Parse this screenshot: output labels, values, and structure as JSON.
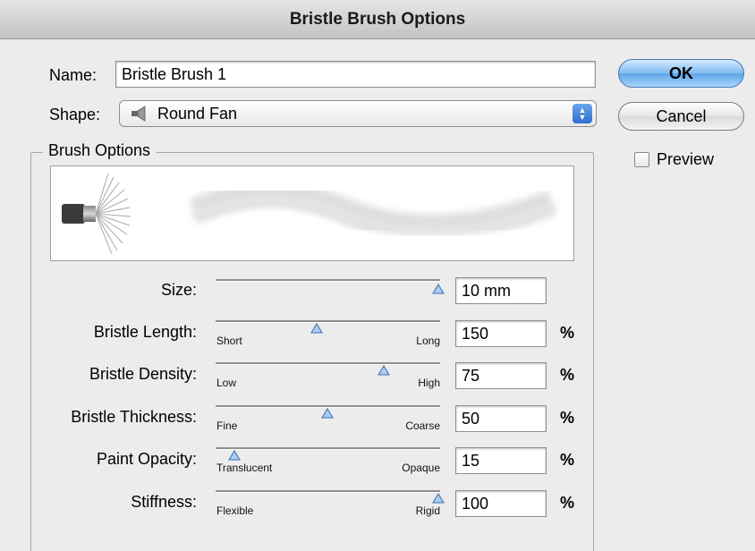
{
  "window": {
    "title": "Bristle Brush Options"
  },
  "name_field": {
    "label": "Name:",
    "value": "Bristle Brush 1"
  },
  "shape": {
    "label": "Shape:",
    "selected": "Round Fan",
    "icon": "fan-brush-icon"
  },
  "buttons": {
    "ok": "OK",
    "cancel": "Cancel"
  },
  "preview": {
    "label": "Preview",
    "checked": false
  },
  "brush_options": {
    "title": "Brush Options",
    "sliders": [
      {
        "label": "Size:",
        "min_label": "",
        "max_label": "",
        "value": "10 mm",
        "unit": "",
        "position": 1.0
      },
      {
        "label": "Bristle Length:",
        "min_label": "Short",
        "max_label": "Long",
        "value": "150",
        "unit": "%",
        "position": 0.45
      },
      {
        "label": "Bristle Density:",
        "min_label": "Low",
        "max_label": "High",
        "value": "75",
        "unit": "%",
        "position": 0.75
      },
      {
        "label": "Bristle Thickness:",
        "min_label": "Fine",
        "max_label": "Coarse",
        "value": "50",
        "unit": "%",
        "position": 0.5
      },
      {
        "label": "Paint Opacity:",
        "min_label": "Translucent",
        "max_label": "Opaque",
        "value": "15",
        "unit": "%",
        "position": 0.06
      },
      {
        "label": "Stiffness:",
        "min_label": "Flexible",
        "max_label": "Rigid",
        "value": "100",
        "unit": "%",
        "position": 1.0
      }
    ]
  },
  "colors": {
    "ok_button": "#7fbaf0",
    "popup_arrows": "#2f6fd0"
  }
}
